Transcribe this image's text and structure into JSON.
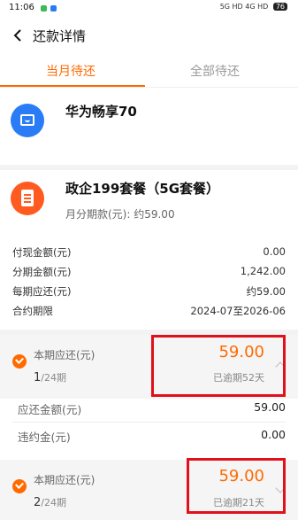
{
  "status_bar": {
    "time": "11:06",
    "right_text": "5G HD 4G HD",
    "battery": "76"
  },
  "nav": {
    "title": "还款详情"
  },
  "tabs": [
    {
      "label": "当月待还"
    },
    {
      "label": "全部待还"
    }
  ],
  "device": {
    "name": "华为畅享70"
  },
  "plan": {
    "name": "政企199套餐（5G套餐）",
    "installment": "月分期款(元): 约59.00"
  },
  "summary": [
    {
      "label": "付现金额(元)",
      "value": "0.00"
    },
    {
      "label": "分期金额(元)",
      "value": "1,242.00"
    },
    {
      "label": "每期应还(元)",
      "value": "约59.00"
    },
    {
      "label": "合约期限",
      "value": "2024-07至2026-06"
    }
  ],
  "periods": [
    {
      "label": "本期应还(元)",
      "index": "1",
      "total": "/24期",
      "amount": "59.00",
      "overdue": "已逾期52天",
      "expanded": true
    },
    {
      "label": "本期应还(元)",
      "index": "2",
      "total": "/24期",
      "amount": "59.00",
      "overdue": "已逾期21天",
      "expanded": false
    }
  ],
  "details": [
    {
      "label": "应还金额(元)",
      "value": "59.00"
    },
    {
      "label": "违约金(元)",
      "value": "0.00"
    }
  ],
  "colors": {
    "accent": "#ff6a00",
    "highlight_box": "#e1101a",
    "device_icon": "#2a7cf6",
    "plan_icon": "#ff5a1f"
  }
}
